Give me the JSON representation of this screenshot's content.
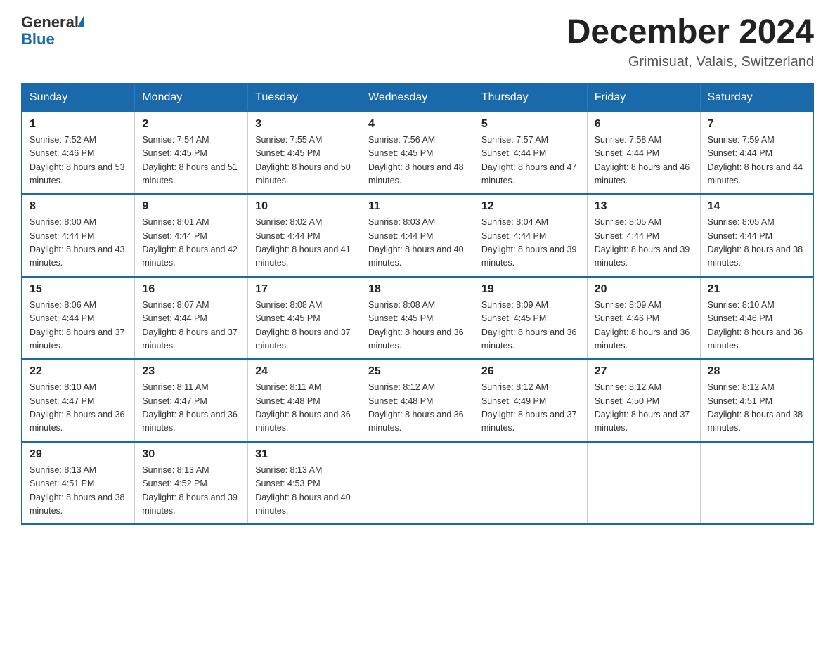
{
  "logo": {
    "general": "General",
    "blue": "Blue"
  },
  "title": "December 2024",
  "subtitle": "Grimisuat, Valais, Switzerland",
  "days_of_week": [
    "Sunday",
    "Monday",
    "Tuesday",
    "Wednesday",
    "Thursday",
    "Friday",
    "Saturday"
  ],
  "weeks": [
    [
      {
        "day": "1",
        "sunrise": "7:52 AM",
        "sunset": "4:46 PM",
        "daylight": "8 hours and 53 minutes."
      },
      {
        "day": "2",
        "sunrise": "7:54 AM",
        "sunset": "4:45 PM",
        "daylight": "8 hours and 51 minutes."
      },
      {
        "day": "3",
        "sunrise": "7:55 AM",
        "sunset": "4:45 PM",
        "daylight": "8 hours and 50 minutes."
      },
      {
        "day": "4",
        "sunrise": "7:56 AM",
        "sunset": "4:45 PM",
        "daylight": "8 hours and 48 minutes."
      },
      {
        "day": "5",
        "sunrise": "7:57 AM",
        "sunset": "4:44 PM",
        "daylight": "8 hours and 47 minutes."
      },
      {
        "day": "6",
        "sunrise": "7:58 AM",
        "sunset": "4:44 PM",
        "daylight": "8 hours and 46 minutes."
      },
      {
        "day": "7",
        "sunrise": "7:59 AM",
        "sunset": "4:44 PM",
        "daylight": "8 hours and 44 minutes."
      }
    ],
    [
      {
        "day": "8",
        "sunrise": "8:00 AM",
        "sunset": "4:44 PM",
        "daylight": "8 hours and 43 minutes."
      },
      {
        "day": "9",
        "sunrise": "8:01 AM",
        "sunset": "4:44 PM",
        "daylight": "8 hours and 42 minutes."
      },
      {
        "day": "10",
        "sunrise": "8:02 AM",
        "sunset": "4:44 PM",
        "daylight": "8 hours and 41 minutes."
      },
      {
        "day": "11",
        "sunrise": "8:03 AM",
        "sunset": "4:44 PM",
        "daylight": "8 hours and 40 minutes."
      },
      {
        "day": "12",
        "sunrise": "8:04 AM",
        "sunset": "4:44 PM",
        "daylight": "8 hours and 39 minutes."
      },
      {
        "day": "13",
        "sunrise": "8:05 AM",
        "sunset": "4:44 PM",
        "daylight": "8 hours and 39 minutes."
      },
      {
        "day": "14",
        "sunrise": "8:05 AM",
        "sunset": "4:44 PM",
        "daylight": "8 hours and 38 minutes."
      }
    ],
    [
      {
        "day": "15",
        "sunrise": "8:06 AM",
        "sunset": "4:44 PM",
        "daylight": "8 hours and 37 minutes."
      },
      {
        "day": "16",
        "sunrise": "8:07 AM",
        "sunset": "4:44 PM",
        "daylight": "8 hours and 37 minutes."
      },
      {
        "day": "17",
        "sunrise": "8:08 AM",
        "sunset": "4:45 PM",
        "daylight": "8 hours and 37 minutes."
      },
      {
        "day": "18",
        "sunrise": "8:08 AM",
        "sunset": "4:45 PM",
        "daylight": "8 hours and 36 minutes."
      },
      {
        "day": "19",
        "sunrise": "8:09 AM",
        "sunset": "4:45 PM",
        "daylight": "8 hours and 36 minutes."
      },
      {
        "day": "20",
        "sunrise": "8:09 AM",
        "sunset": "4:46 PM",
        "daylight": "8 hours and 36 minutes."
      },
      {
        "day": "21",
        "sunrise": "8:10 AM",
        "sunset": "4:46 PM",
        "daylight": "8 hours and 36 minutes."
      }
    ],
    [
      {
        "day": "22",
        "sunrise": "8:10 AM",
        "sunset": "4:47 PM",
        "daylight": "8 hours and 36 minutes."
      },
      {
        "day": "23",
        "sunrise": "8:11 AM",
        "sunset": "4:47 PM",
        "daylight": "8 hours and 36 minutes."
      },
      {
        "day": "24",
        "sunrise": "8:11 AM",
        "sunset": "4:48 PM",
        "daylight": "8 hours and 36 minutes."
      },
      {
        "day": "25",
        "sunrise": "8:12 AM",
        "sunset": "4:48 PM",
        "daylight": "8 hours and 36 minutes."
      },
      {
        "day": "26",
        "sunrise": "8:12 AM",
        "sunset": "4:49 PM",
        "daylight": "8 hours and 37 minutes."
      },
      {
        "day": "27",
        "sunrise": "8:12 AM",
        "sunset": "4:50 PM",
        "daylight": "8 hours and 37 minutes."
      },
      {
        "day": "28",
        "sunrise": "8:12 AM",
        "sunset": "4:51 PM",
        "daylight": "8 hours and 38 minutes."
      }
    ],
    [
      {
        "day": "29",
        "sunrise": "8:13 AM",
        "sunset": "4:51 PM",
        "daylight": "8 hours and 38 minutes."
      },
      {
        "day": "30",
        "sunrise": "8:13 AM",
        "sunset": "4:52 PM",
        "daylight": "8 hours and 39 minutes."
      },
      {
        "day": "31",
        "sunrise": "8:13 AM",
        "sunset": "4:53 PM",
        "daylight": "8 hours and 40 minutes."
      },
      null,
      null,
      null,
      null
    ]
  ]
}
